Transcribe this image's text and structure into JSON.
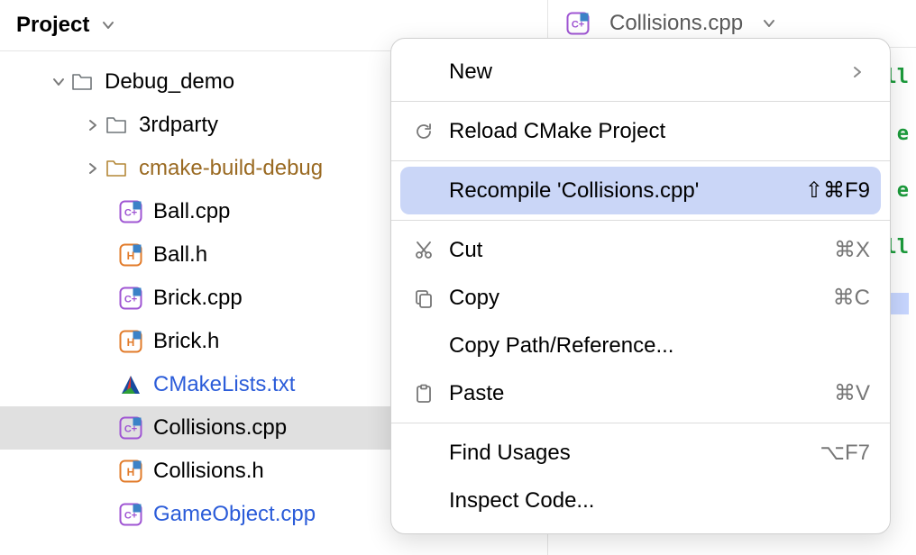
{
  "sidebar": {
    "title": "Project",
    "root": {
      "label": "Debug_demo"
    },
    "items": [
      {
        "label": "3rdparty",
        "type": "folder"
      },
      {
        "label": "cmake-build-debug",
        "type": "folder-excluded"
      },
      {
        "label": "Ball.cpp",
        "type": "cpp"
      },
      {
        "label": "Ball.h",
        "type": "h"
      },
      {
        "label": "Brick.cpp",
        "type": "cpp"
      },
      {
        "label": "Brick.h",
        "type": "h"
      },
      {
        "label": "CMakeLists.txt",
        "type": "cmake"
      },
      {
        "label": "Collisions.cpp",
        "type": "cpp"
      },
      {
        "label": "Collisions.h",
        "type": "h"
      },
      {
        "label": "GameObject.cpp",
        "type": "cpp"
      }
    ]
  },
  "editor": {
    "tab_label": "Collisions.cpp",
    "code_frag_1": "ll",
    "code_frag_2": "e",
    "code_frag_3": "e",
    "code_frag_4": "ll"
  },
  "menu": {
    "new": "New",
    "reload": "Reload CMake Project",
    "recompile": "Recompile 'Collisions.cpp'",
    "recompile_shortcut": "⇧⌘F9",
    "cut": "Cut",
    "cut_shortcut": "⌘X",
    "copy": "Copy",
    "copy_shortcut": "⌘C",
    "copy_path": "Copy Path/Reference...",
    "paste": "Paste",
    "paste_shortcut": "⌘V",
    "find_usages": "Find Usages",
    "find_usages_shortcut": "⌥F7",
    "inspect": "Inspect Code..."
  }
}
